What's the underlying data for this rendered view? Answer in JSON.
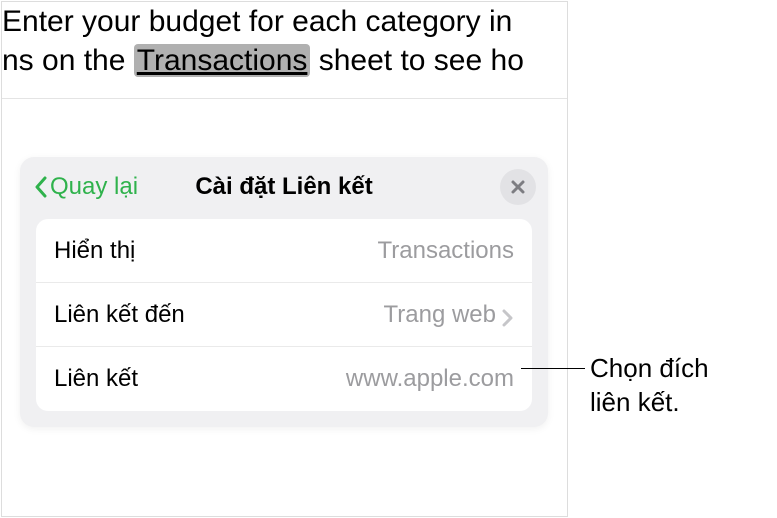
{
  "document": {
    "line1_prefix": "Enter your budget for each category in",
    "line2_prefix": "ns on the ",
    "selected_word": "Transactions",
    "line2_suffix": " sheet to see ho"
  },
  "popover": {
    "back_label": "Quay lại",
    "title": "Cài đặt Liên kết",
    "rows": {
      "display": {
        "label": "Hiển thị",
        "value": "Transactions"
      },
      "linkto": {
        "label": "Liên kết đến",
        "value": "Trang web"
      },
      "link": {
        "label": "Liên kết",
        "value": "www.apple.com"
      }
    }
  },
  "callout": {
    "line1": "Chọn đích",
    "line2": "liên kết."
  }
}
